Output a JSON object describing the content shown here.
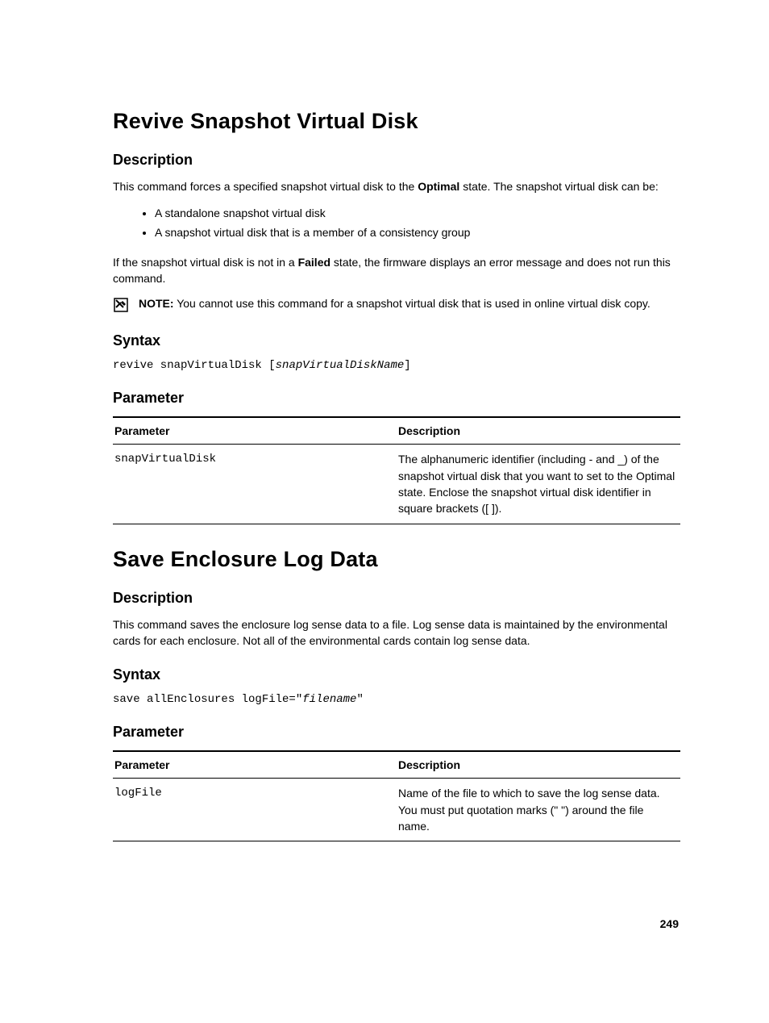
{
  "page_number": "249",
  "section1": {
    "title": "Revive Snapshot Virtual Disk",
    "desc_heading": "Description",
    "desc_p1_a": "This command forces a specified snapshot virtual disk to the ",
    "desc_p1_bold": "Optimal",
    "desc_p1_b": " state. The snapshot virtual disk can be:",
    "bullets": [
      "A standalone snapshot virtual disk",
      "A snapshot virtual disk that is a member of a consistency group"
    ],
    "desc_p2_a": "If the snapshot virtual disk is not in a ",
    "desc_p2_bold": "Failed",
    "desc_p2_b": " state, the firmware displays an error message and does not run this command.",
    "note_label": "NOTE:",
    "note_text": " You cannot use this command for a snapshot virtual disk that is used in online virtual disk copy.",
    "syntax_heading": "Syntax",
    "syntax_plain_a": "revive snapVirtualDisk [",
    "syntax_italic": "snapVirtualDiskName",
    "syntax_plain_b": "]",
    "param_heading": "Parameter",
    "table": {
      "col1": "Parameter",
      "col2": "Description",
      "row1_param": "snapVirtualDisk",
      "row1_desc": "The alphanumeric identifier (including - and _) of the snapshot virtual disk that you want to set to the Optimal state. Enclose the snapshot virtual disk identifier in square brackets ([ ])."
    }
  },
  "section2": {
    "title": "Save Enclosure Log Data",
    "desc_heading": "Description",
    "desc_p1": "This command saves the enclosure log sense data to a file. Log sense data is maintained by the environmental cards for each enclosure. Not all of the environmental cards contain log sense data.",
    "syntax_heading": "Syntax",
    "syntax_plain_a": "save allEnclosures logFile=\"",
    "syntax_italic": "filename",
    "syntax_plain_b": "\"",
    "param_heading": "Parameter",
    "table": {
      "col1": "Parameter",
      "col2": "Description",
      "row1_param": "logFile",
      "row1_desc": "Name of the file to which to save the log sense data. You must put quotation marks (\" \") around the file name."
    }
  }
}
